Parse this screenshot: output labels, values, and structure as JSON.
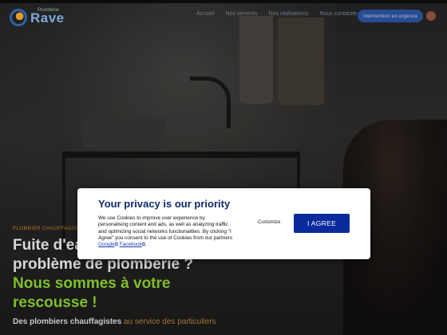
{
  "logo": {
    "text": "Rave",
    "small": "Plomberie"
  },
  "nav": {
    "items": [
      "Accueil",
      "Nos services",
      "Nos réalisations",
      "Nous contacter"
    ]
  },
  "header": {
    "phone_label": "Intervention en urgence"
  },
  "hero": {
    "tagline": "PLOMBIER CHAUFFAGISTE",
    "line1": "Fuite d'eau",
    "line2": "problème de plomberie ?",
    "line3": "Nous sommes à votre",
    "line4": "rescousse !",
    "sub_bold": "Des plombiers chauffagistes",
    "sub_rest": " au service des particuliers"
  },
  "cookie": {
    "title": "Your privacy is our priority",
    "text": "We use Cookies to improve user experience by personalising content and ads, as well as analyzing traffic and optimizing social networks functionalities. By clicking \"I Agree\" you consent to the use of Cookies from our partners ",
    "link_google": "Google",
    "link_facebook": "Facebook",
    "customize_label": "Customize",
    "agree_label": "I AGREE"
  },
  "colors": {
    "accent_blue": "#0a2a9c",
    "title_blue": "#0d2b6b",
    "green": "#7fbf2b"
  }
}
